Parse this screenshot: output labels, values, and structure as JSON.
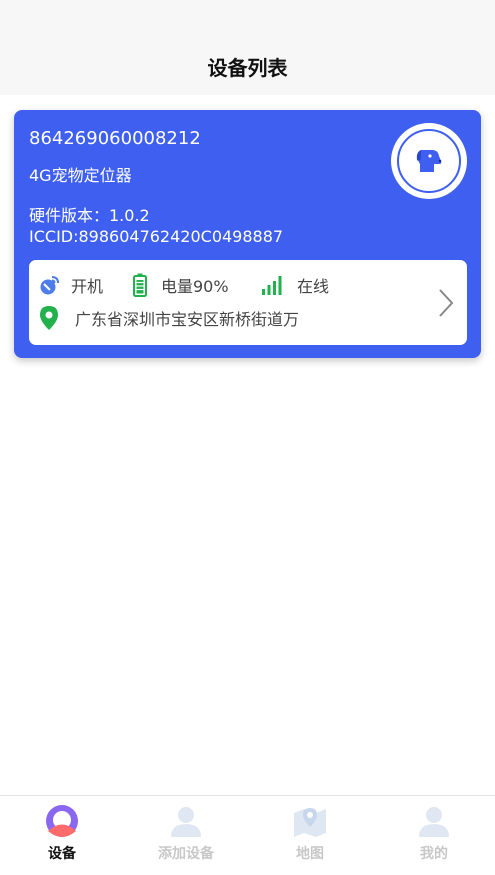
{
  "header": {
    "title": "设备列表"
  },
  "device": {
    "imei": "864269060008212",
    "model": "4G宠物定位器",
    "hardware_version": "硬件版本：1.0.2",
    "iccid": "ICCID:898604762420C0498887",
    "status": {
      "power": "开机",
      "battery": "电量90%",
      "battery_level": 0.9,
      "signal": "在线",
      "address": "广东省深圳市宝安区新桥街道万"
    },
    "icon": "dog-icon"
  },
  "tabbar": {
    "items": [
      {
        "label": "设备",
        "icon": "device-icon",
        "active": true
      },
      {
        "label": "添加设备",
        "icon": "add-device-icon",
        "active": false
      },
      {
        "label": "地图",
        "icon": "map-icon",
        "active": false
      },
      {
        "label": "我的",
        "icon": "profile-icon",
        "active": false
      }
    ]
  },
  "colors": {
    "accent": "#3e5ff0",
    "green": "#22b14c",
    "tab_inactive": "#c8c8c8",
    "tab_active_icon": "#8a67f0"
  }
}
